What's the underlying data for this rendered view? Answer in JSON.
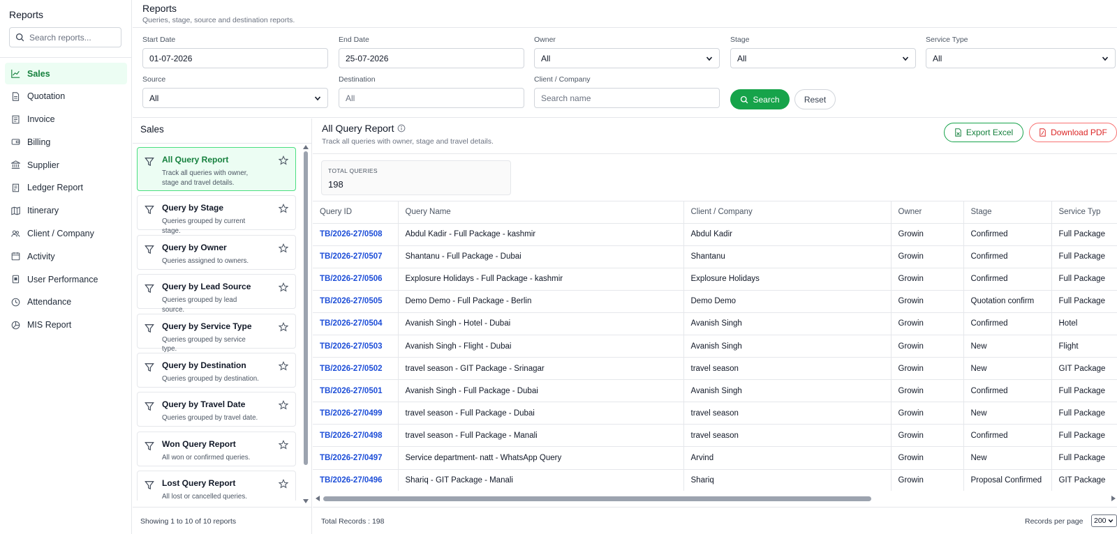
{
  "sidebar": {
    "title": "Reports",
    "search_placeholder": "Search reports...",
    "items": [
      {
        "label": "Sales",
        "icon": "chart-line-icon"
      },
      {
        "label": "Quotation",
        "icon": "document-icon"
      },
      {
        "label": "Invoice",
        "icon": "invoice-icon"
      },
      {
        "label": "Billing",
        "icon": "wallet-icon"
      },
      {
        "label": "Supplier",
        "icon": "bank-icon"
      },
      {
        "label": "Ledger Report",
        "icon": "ledger-icon"
      },
      {
        "label": "Itinerary",
        "icon": "map-icon"
      },
      {
        "label": "Client / Company",
        "icon": "users-icon"
      },
      {
        "label": "Activity",
        "icon": "calendar-icon"
      },
      {
        "label": "User Performance",
        "icon": "badge-icon"
      },
      {
        "label": "Attendance",
        "icon": "clock-icon"
      },
      {
        "label": "MIS Report",
        "icon": "pie-chart-icon"
      }
    ]
  },
  "header": {
    "title": "Reports",
    "subtitle": "Queries, stage, source and destination reports."
  },
  "filters": {
    "start_date": {
      "label": "Start Date",
      "value": "01-07-2026"
    },
    "end_date": {
      "label": "End Date",
      "value": "25-07-2026"
    },
    "owner": {
      "label": "Owner",
      "value": "All"
    },
    "stage": {
      "label": "Stage",
      "value": "All"
    },
    "service_type": {
      "label": "Service Type",
      "value": "All"
    },
    "source": {
      "label": "Source",
      "value": "All"
    },
    "destination": {
      "label": "Destination",
      "placeholder": "All"
    },
    "client": {
      "label": "Client / Company",
      "placeholder": "Search name"
    },
    "search_label": "Search",
    "reset_label": "Reset"
  },
  "report_list": {
    "title": "Sales",
    "items": [
      {
        "title": "All Query Report",
        "desc": "Track all queries with owner, stage and travel details."
      },
      {
        "title": "Query by Stage",
        "desc": "Queries grouped by current stage."
      },
      {
        "title": "Query by Owner",
        "desc": "Queries assigned to owners."
      },
      {
        "title": "Query by Lead Source",
        "desc": "Queries grouped by lead source."
      },
      {
        "title": "Query by Service Type",
        "desc": "Queries grouped by service type."
      },
      {
        "title": "Query by Destination",
        "desc": "Queries grouped by destination."
      },
      {
        "title": "Query by Travel Date",
        "desc": "Queries grouped by travel date."
      },
      {
        "title": "Won Query Report",
        "desc": "All won or confirmed queries."
      },
      {
        "title": "Lost Query Report",
        "desc": "All lost or cancelled queries."
      }
    ],
    "footer": "Showing 1 to 10 of 10 reports"
  },
  "report": {
    "title": "All Query Report",
    "subtitle": "Track all queries with owner, stage and travel details.",
    "export_excel": "Export Excel",
    "download_pdf": "Download PDF",
    "stat_label": "TOTAL QUERIES",
    "stat_value": "198",
    "columns": [
      "Query ID",
      "Query Name",
      "Client / Company",
      "Owner",
      "Stage",
      "Service Typ"
    ],
    "rows": [
      [
        "TB/2026-27/0508",
        "Abdul Kadir - Full Package - kashmir",
        "Abdul Kadir",
        "Growin",
        "Confirmed",
        "Full Package"
      ],
      [
        "TB/2026-27/0507",
        "Shantanu - Full Package - Dubai",
        "Shantanu",
        "Growin",
        "Confirmed",
        "Full Package"
      ],
      [
        "TB/2026-27/0506",
        "Explosure Holidays - Full Package - kashmir",
        "Explosure Holidays",
        "Growin",
        "Confirmed",
        "Full Package"
      ],
      [
        "TB/2026-27/0505",
        "Demo Demo - Full Package - Berlin",
        "Demo Demo",
        "Growin",
        "Quotation confirm",
        "Full Package"
      ],
      [
        "TB/2026-27/0504",
        "Avanish Singh - Hotel - Dubai",
        "Avanish Singh",
        "Growin",
        "Confirmed",
        "Hotel"
      ],
      [
        "TB/2026-27/0503",
        "Avanish Singh - Flight - Dubai",
        "Avanish Singh",
        "Growin",
        "New",
        "Flight"
      ],
      [
        "TB/2026-27/0502",
        "travel season - GIT Package - Srinagar",
        "travel season",
        "Growin",
        "New",
        "GIT Package"
      ],
      [
        "TB/2026-27/0501",
        "Avanish Singh - Full Package - Dubai",
        "Avanish Singh",
        "Growin",
        "Confirmed",
        "Full Package"
      ],
      [
        "TB/2026-27/0499",
        "travel season - Full Package - Dubai",
        "travel season",
        "Growin",
        "New",
        "Full Package"
      ],
      [
        "TB/2026-27/0498",
        "travel season - Full Package - Manali",
        "travel season",
        "Growin",
        "Confirmed",
        "Full Package"
      ],
      [
        "TB/2026-27/0497",
        "Service department- natt - WhatsApp Query",
        "Arvind",
        "Growin",
        "New",
        "Full Package"
      ],
      [
        "TB/2026-27/0496",
        "Shariq - GIT Package - Manali",
        "Shariq",
        "Growin",
        "Proposal Confirmed",
        "GIT Package"
      ]
    ],
    "total_records": "Total Records : 198",
    "records_per_page_label": "Records per page",
    "records_per_page": "200"
  },
  "colors": {
    "accent": "#16a34a",
    "accent_bg": "#ecfdf3",
    "link": "#1d4ed8",
    "danger": "#dc2626"
  }
}
